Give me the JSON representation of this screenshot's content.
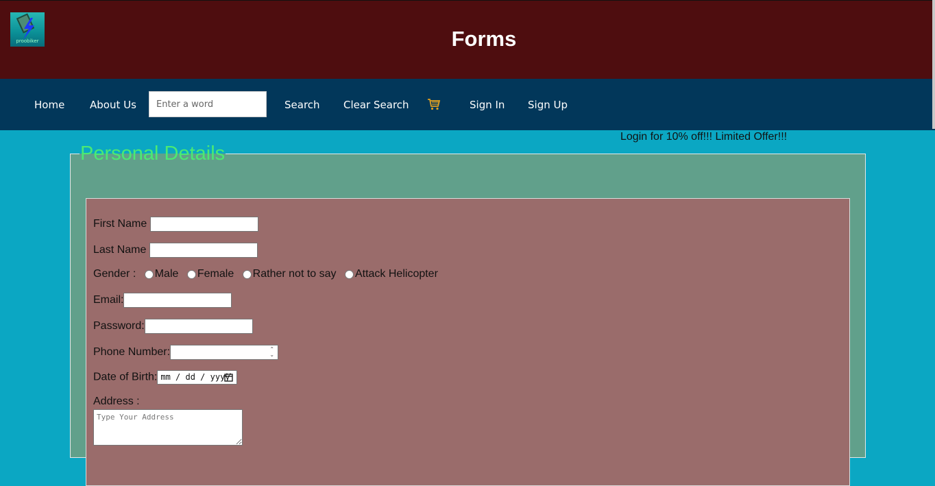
{
  "header": {
    "title": "Forms",
    "logo_text": "proobiker"
  },
  "nav": {
    "home": "Home",
    "about": "About Us",
    "search_placeholder": "Enter a word",
    "search": "Search",
    "clear_search": "Clear Search",
    "cart_icon": "cart-icon",
    "sign_in": "Sign In",
    "sign_up": "Sign Up"
  },
  "promo": "Login for 10% off!!! Limited Offer!!!",
  "form": {
    "legend": "Personal Details",
    "first_name_label": "First Name",
    "last_name_label": "Last Name",
    "gender_label": "Gender :",
    "gender_options": [
      "Male",
      "Female",
      "Rather not to say",
      "Attack Helicopter"
    ],
    "email_label": "Email:",
    "password_label": "Password:",
    "phone_label": "Phone Number:",
    "dob_label": "Date of Birth:",
    "dob_placeholder": "mm / dd / yyyy",
    "address_label": "Address :",
    "address_placeholder": "Type Your Address"
  },
  "colors": {
    "header_bg": "#4e0d0f",
    "nav_bg": "#02375a",
    "page_bg": "#0ba7c3",
    "fieldset_bg": "#61a08b",
    "inner_bg": "#9a6c6b",
    "legend": "#4bea73"
  }
}
